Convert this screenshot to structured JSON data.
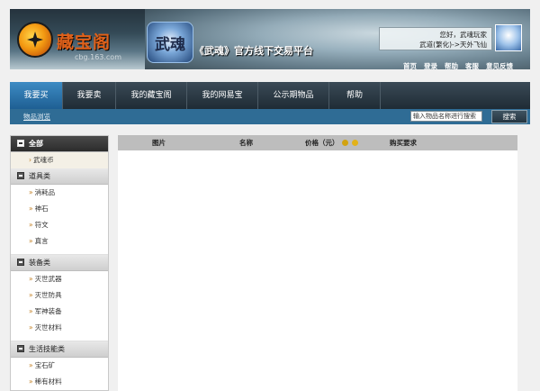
{
  "header": {
    "logo_text": "藏宝阁",
    "logo_sub": "cbg.163.com",
    "game_logo_text": "武魂",
    "platform_title": "《武魂》官方线下交易平台",
    "greeting": "您好，武魂玩家",
    "server_info": "武道(繁化)->天外飞仙",
    "top_links": [
      "首页",
      "登录",
      "帮助",
      "客服",
      "意见反馈"
    ]
  },
  "nav": {
    "tabs": [
      "我要买",
      "我要卖",
      "我的藏宝阁",
      "我的网易宝",
      "公示期物品",
      "帮助"
    ],
    "active_index": 0
  },
  "subnav": {
    "link": "物品浏览"
  },
  "search": {
    "placeholder": "输入物品名称进行搜索",
    "button": "搜索"
  },
  "sidebar": {
    "all_label": "全部",
    "currency_item": "武魂币",
    "groups": [
      {
        "label": "道具类",
        "items": [
          "消耗品",
          "神石",
          "符文",
          "真言"
        ]
      },
      {
        "label": "装备类",
        "items": [
          "灭世武器",
          "灭世防具",
          "军神装备",
          "灭世材料"
        ]
      },
      {
        "label": "生活技能类",
        "items": [
          "宝石矿",
          "稀有材料"
        ]
      }
    ]
  },
  "table": {
    "columns": [
      "图片",
      "名称",
      "价格（元）",
      "购买要求"
    ]
  },
  "colors": {
    "nav_active": "#2a74ad",
    "subnav_bg": "#2f6c95",
    "logo_orange": "#e0611a"
  }
}
